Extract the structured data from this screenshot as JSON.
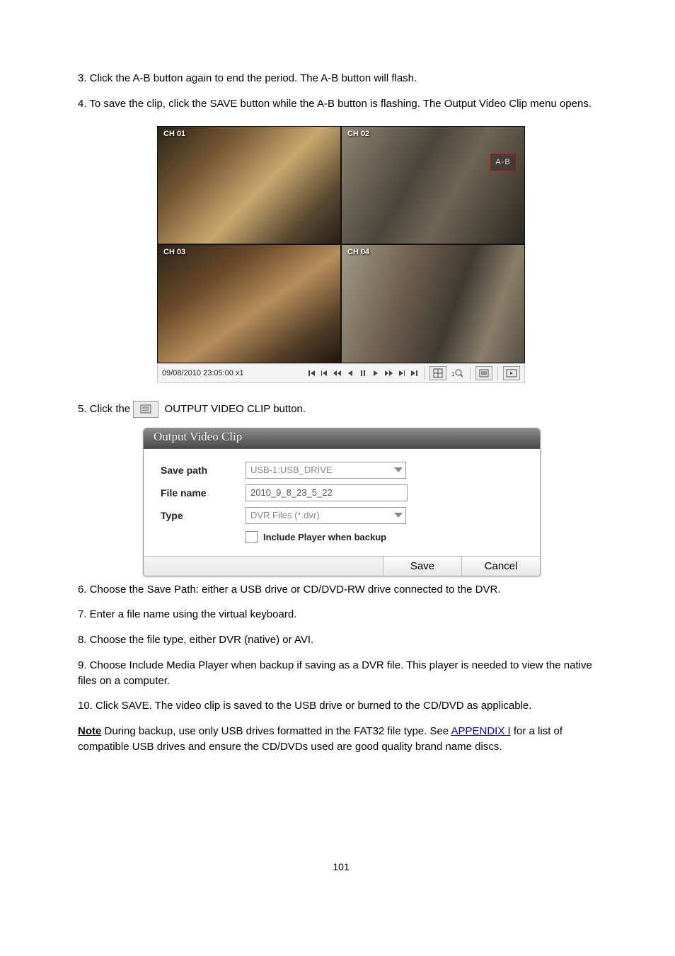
{
  "intro": {
    "p1": "3.  Click the A-B button again to end the period. The A-B button will flash.",
    "p2": "4.  To save the clip, click the SAVE button while the A-B button is flashing. The Output Video Clip menu opens."
  },
  "player": {
    "channels": [
      "CH 01",
      "CH 02",
      "CH 03",
      "CH 04"
    ],
    "ab_label": "A-B",
    "timestamp": "09/08/2010 23:05:00  x1"
  },
  "body": {
    "click_line_prefix": "5.  Click the  ",
    "click_line_suffix": "  OUTPUT VIDEO CLIP button.",
    "after_dialog_a": "6.  Choose the Save Path: either a USB drive or CD/DVD-RW drive connected to the DVR.",
    "after_dialog_b": "7.  Enter a file name using the virtual keyboard.",
    "after_dialog_c": "8.  Choose the file type, either DVR (native) or AVI.",
    "after_dialog_d": "9.  Choose Include Media Player when backup if saving as a DVR file. This player is needed to view the native files on a computer.",
    "after_dialog_e": "10.  Click SAVE. The video clip is saved to the USB drive or burned to the CD/DVD as applicable."
  },
  "dialog": {
    "title": "Output Video Clip",
    "labels": {
      "save_path": "Save path",
      "file_name": "File name",
      "type": "Type"
    },
    "values": {
      "save_path": "USB-1:USB_DRIVE",
      "file_name": "2010_9_8_23_5_22",
      "type": "DVR Files (*.dvr)"
    },
    "checkbox_label": "Include Player when backup",
    "buttons": {
      "save": "Save",
      "cancel": "Cancel"
    }
  },
  "note": {
    "label": "Note",
    "text_before": "  During backup, use only USB drives formatted in the FAT32 file type. See ",
    "link_text": "APPENDIX I",
    "text_after": " for a list of compatible USB drives and ensure the CD/DVDs used are good quality brand name discs."
  },
  "page_number": "101"
}
